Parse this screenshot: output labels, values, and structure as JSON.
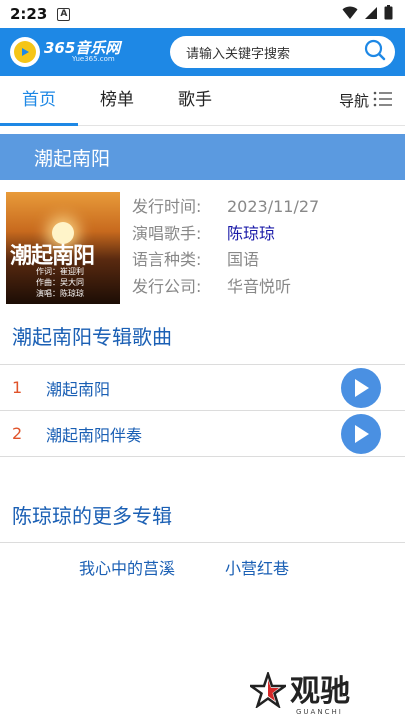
{
  "status_bar": {
    "time": "2:23",
    "notification_glyph": "A",
    "icons": [
      "wifi-icon",
      "signal-icon",
      "battery-icon"
    ]
  },
  "header": {
    "logo_text": "365音乐网",
    "logo_sub": "Yue365.com",
    "search_placeholder": "请输入关键字搜索",
    "colors": {
      "header_bg": "#1e88e5"
    }
  },
  "tabs": [
    {
      "label": "首页",
      "active": true
    },
    {
      "label": "榜单",
      "active": false
    },
    {
      "label": "歌手",
      "active": false
    }
  ],
  "nav_label": "导航",
  "album": {
    "title": "潮起南阳",
    "cover_title": "潮起南阳",
    "cover_credits": [
      "作词：崔迎利",
      "作曲：吴大同",
      "演唱：陈琼琼"
    ],
    "fields": [
      {
        "key": "发行时间:",
        "value": "2023/11/27"
      },
      {
        "key": "演唱歌手:",
        "value": "陈琼琼"
      },
      {
        "key": "语言种类:",
        "value": "国语"
      },
      {
        "key": "发行公司:",
        "value": "华音悦听"
      }
    ]
  },
  "songs_section": {
    "title": "潮起南阳专辑歌曲",
    "songs": [
      {
        "num": "1",
        "name": "潮起南阳"
      },
      {
        "num": "2",
        "name": "潮起南阳伴奏"
      }
    ]
  },
  "more_section": {
    "title": "陈琼琼的更多专辑",
    "albums": [
      "我心中的莒溪",
      "小营红巷"
    ]
  },
  "watermark": {
    "text": "观驰",
    "sub": "GUANCHI"
  }
}
